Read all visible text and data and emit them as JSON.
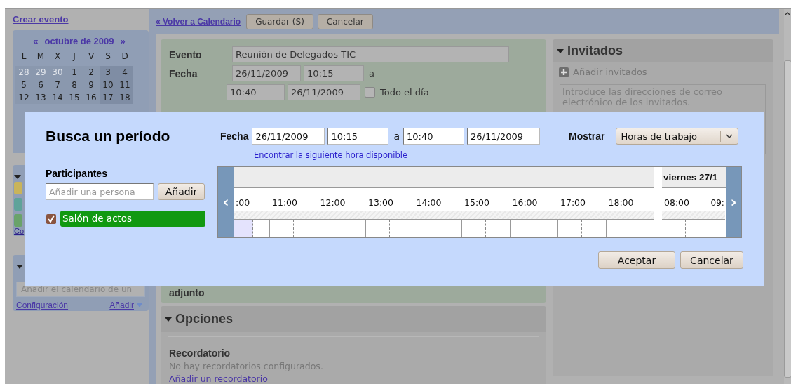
{
  "sidebar": {
    "create_link": "Crear evento",
    "mini_calendar": {
      "prev": "«",
      "month": "octubre de 2009",
      "next": "»",
      "weekdays": [
        "L",
        "M",
        "X",
        "J",
        "V",
        "S",
        "D"
      ],
      "weeks": [
        [
          {
            "day": "28",
            "other_month": true
          },
          {
            "day": "29",
            "other_month": true
          },
          {
            "day": "30",
            "other_month": true
          },
          {
            "day": "1",
            "other_month": false
          },
          {
            "day": "2",
            "other_month": false
          },
          {
            "day": "3",
            "other_month": false
          },
          {
            "day": "4",
            "other_month": false
          }
        ],
        [
          {
            "day": "5",
            "other_month": false
          },
          {
            "day": "6",
            "other_month": false
          },
          {
            "day": "7",
            "other_month": false
          },
          {
            "day": "8",
            "other_month": false
          },
          {
            "day": "9",
            "other_month": false
          },
          {
            "day": "10",
            "other_month": false
          },
          {
            "day": "11",
            "other_month": false
          }
        ],
        [
          {
            "day": "12",
            "other_month": false
          },
          {
            "day": "13",
            "other_month": false
          },
          {
            "day": "14",
            "other_month": false
          },
          {
            "day": "15",
            "other_month": false
          },
          {
            "day": "16",
            "other_month": false
          },
          {
            "day": "17",
            "other_month": false
          },
          {
            "day": "18",
            "other_month": false
          }
        ]
      ]
    },
    "calendars": {
      "chips": [
        {
          "color": "#c9b45a"
        },
        {
          "color": "#5fa39a"
        },
        {
          "color": "#6aa36a"
        }
      ],
      "link": "Co"
    },
    "other_calendars": {
      "placeholder": "Añadir el calendario de un",
      "settings_link": "Configuración",
      "add_link": "Añadir"
    }
  },
  "toolbar": {
    "back_link": "« Volver a Calendario",
    "buttons": [
      "Guardar (S)",
      "Cancelar"
    ]
  },
  "event": {
    "title_label": "Evento",
    "title_value": "Reunión de Delegados TIC",
    "date_label": "Fecha",
    "start_date": "26/11/2009",
    "start_time": "10:15",
    "to": "a",
    "end_time": "10:40",
    "end_date": "26/11/2009",
    "all_day_label": "Todo el día",
    "all_day": false,
    "attachment_label": "adjunto"
  },
  "guests": {
    "title": "Invitados",
    "add_label": "Añadir invitados",
    "placeholder": "Introduce las direcciones de correo electrónico de los invitados."
  },
  "options": {
    "title": "Opciones",
    "reminder_label": "Recordatorio",
    "reminder_text": "No hay recordatorios configurados.",
    "reminder_link": "Añadir un recordatorio"
  },
  "dialog": {
    "title": "Busca un período",
    "date_label": "Fecha",
    "start_date": "26/11/2009",
    "start_time": "10:15",
    "to": "a",
    "end_time": "10:40",
    "end_date": "26/11/2009",
    "next_link": "Encontrar la siguiente hora disponible",
    "show_label": "Mostrar",
    "show_value": "Horas de trabajo",
    "participants_label": "Participantes",
    "person_placeholder": "Añadir una persona",
    "add_button": "Añadir",
    "participants": [
      {
        "name": "Salón de actos",
        "checked": true,
        "color": "#119911"
      }
    ],
    "timeline": {
      "prev": "‹",
      "next": "›",
      "days": [
        {
          "hours": [
            {
              "label": ":00",
              "kind": "partial",
              "selected": true
            },
            {
              "label": "11:00",
              "kind": "full",
              "selected": false
            },
            {
              "label": "12:00",
              "kind": "full",
              "selected": false
            },
            {
              "label": "13:00",
              "kind": "full",
              "selected": false
            },
            {
              "label": "14:00",
              "kind": "full",
              "selected": false
            },
            {
              "label": "15:00",
              "kind": "full",
              "selected": false
            },
            {
              "label": "16:00",
              "kind": "full",
              "selected": false
            },
            {
              "label": "17:00",
              "kind": "full",
              "selected": false
            },
            {
              "label": "18:00",
              "kind": "full",
              "selected": false
            }
          ]
        },
        {
          "header": "viernes 27/1",
          "hours": [
            {
              "label": "08:00",
              "kind": "full",
              "selected": false
            },
            {
              "label": "09:",
              "kind": "end",
              "selected": false
            }
          ]
        }
      ]
    },
    "buttons": [
      "Aceptar",
      "Cancelar"
    ]
  }
}
